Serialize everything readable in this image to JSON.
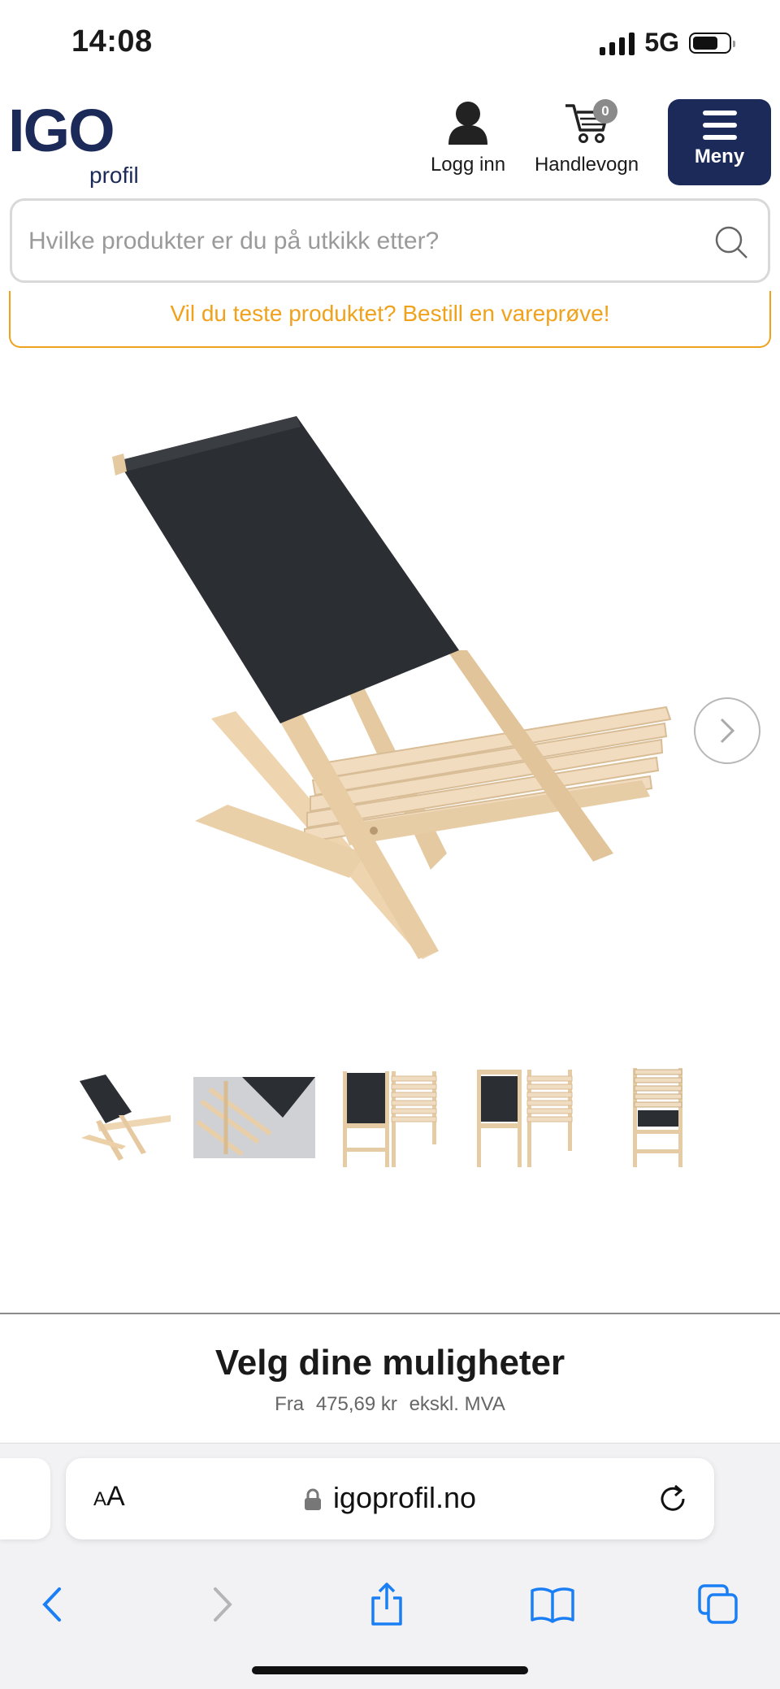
{
  "status_bar": {
    "time": "14:08",
    "network": "5G"
  },
  "header": {
    "logo_main": "IGO",
    "logo_sub": "profil",
    "login_label": "Logg inn",
    "cart_label": "Handlevogn",
    "cart_count": "0",
    "menu_label": "Meny",
    "brand_color": "#1c2a5a"
  },
  "search": {
    "placeholder": "Hvilke produkter er du på utkikk etter?"
  },
  "sample_banner": {
    "text": "Vil du teste produktet? Bestill en vareprøve!",
    "color": "#f0a21d"
  },
  "product": {
    "image_icon": "beach-chair-image",
    "thumbnails": [
      {
        "label": "beach-chair-angle-thumb"
      },
      {
        "label": "beach-chair-closeup-thumb"
      },
      {
        "label": "beach-chair-front-back-thumb"
      },
      {
        "label": "beach-chair-front-back-thumb-2"
      },
      {
        "label": "beach-chair-folded-thumb"
      }
    ]
  },
  "options": {
    "title": "Velg dine muligheter",
    "price_prefix": "Fra",
    "price": "475,69 kr",
    "price_suffix": "ekskl. MVA"
  },
  "browser": {
    "aa_small": "A",
    "aa_large": "A",
    "url": "igoprofil.no",
    "accent": "#1a7ef5"
  }
}
